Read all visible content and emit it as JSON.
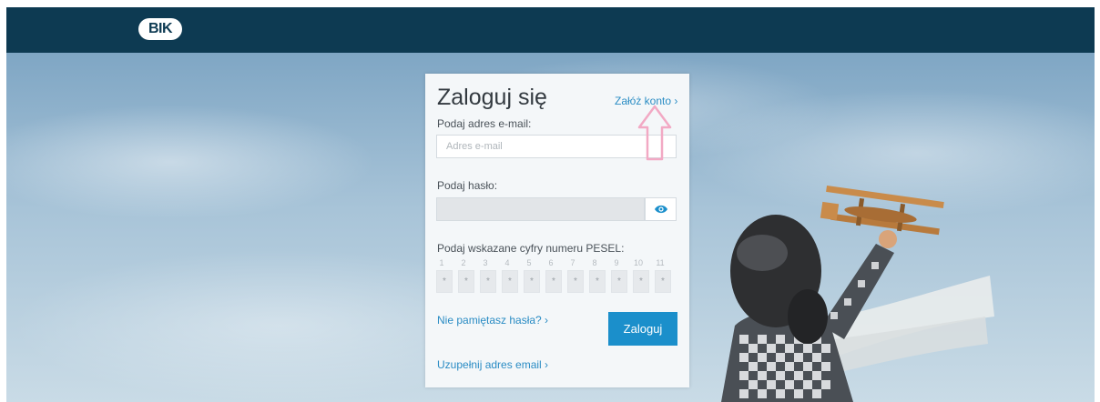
{
  "header": {
    "logo_text": "BIK"
  },
  "login": {
    "title": "Zaloguj się",
    "register_link": "Załóż konto ›",
    "email_label": "Podaj adres e-mail:",
    "email_placeholder": "Adres e-mail",
    "email_value": "",
    "password_label": "Podaj hasło:",
    "password_value": "",
    "pesel_label": "Podaj wskazane cyfry numeru PESEL:",
    "pesel_positions": [
      "1",
      "2",
      "3",
      "4",
      "5",
      "6",
      "7",
      "8",
      "9",
      "10",
      "11"
    ],
    "pesel_digits": [
      "*",
      "*",
      "*",
      "*",
      "*",
      "*",
      "*",
      "*",
      "*",
      "*",
      "*"
    ],
    "forgot_link": "Nie pamiętasz hasła? ›",
    "submit_label": "Zaloguj",
    "complete_email_link": "Uzupełnij adres email ›"
  },
  "icons": {
    "password_toggle": "eye-icon",
    "annotation": "up-arrow-icon"
  },
  "colors": {
    "header": "#0d3a52",
    "accent": "#1b8fcb",
    "link": "#2a8cc4",
    "annotation": "#f2a9c4"
  }
}
